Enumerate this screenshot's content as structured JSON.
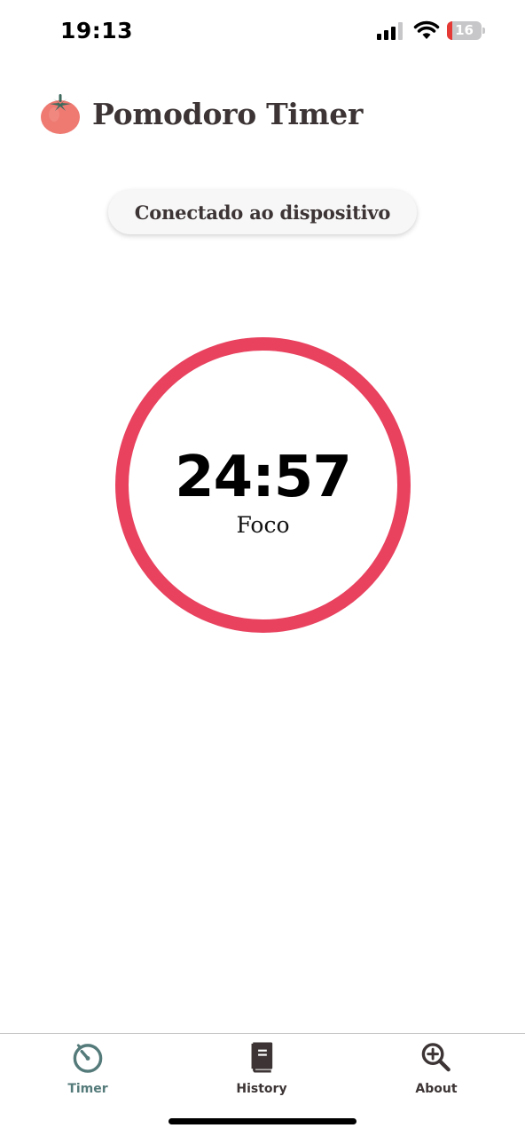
{
  "status_bar": {
    "time": "19:13",
    "battery_level": "16",
    "icons": [
      "signal-icon",
      "wifi-icon",
      "battery-icon"
    ]
  },
  "header": {
    "title": "Pomodoro Timer",
    "logo_icon": "tomato-icon"
  },
  "connection": {
    "label": "Conectado ao dispositivo"
  },
  "timer": {
    "time": "24:57",
    "mode": "Foco",
    "ring_color": "#e8425f"
  },
  "bottom_nav": {
    "items": [
      {
        "label": "Timer",
        "icon": "timer-icon",
        "active": true
      },
      {
        "label": "History",
        "icon": "book-icon",
        "active": false
      },
      {
        "label": "About",
        "icon": "zoom-in-icon",
        "active": false
      }
    ]
  },
  "colors": {
    "accent": "#e8425f",
    "active_tab": "#557a7a",
    "text_dark": "#3d3535"
  }
}
